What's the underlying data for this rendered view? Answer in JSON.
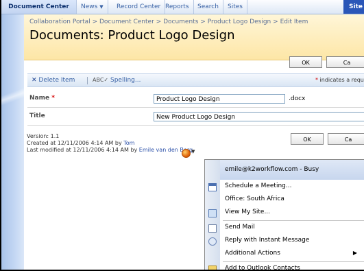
{
  "topnav": {
    "active_tab": "Document Center",
    "tabs": [
      "News",
      "Record Center",
      "Reports",
      "Search",
      "Sites"
    ],
    "site_label": "Site"
  },
  "breadcrumb": {
    "items": [
      "Collaboration Portal",
      "Document Center",
      "Documents",
      "Product Logo Design",
      "Edit Item"
    ],
    "separator": ">"
  },
  "page": {
    "title": "Documents: Product Logo Design"
  },
  "buttons": {
    "ok": "OK",
    "cancel": "Ca"
  },
  "toolbar": {
    "delete_label": "Delete Item",
    "spelling_label": "Spelling...",
    "required_note": "indicates a requi",
    "required_star": "*"
  },
  "form": {
    "name": {
      "label": "Name",
      "star": "*",
      "value": "Product Logo Design",
      "extension": ".docx"
    },
    "title": {
      "label": "Title",
      "value": "New Product Logo Design"
    }
  },
  "meta": {
    "version": "Version: 1.1",
    "created_prefix": "Created at 12/11/2006 4:14 AM  by",
    "created_by": "Tom",
    "modified_prefix": "Last modified at 12/11/2006 4:14 AM  by",
    "modified_by": "Emile van den Berg"
  },
  "context_menu": {
    "header": "emile@k2workflow.com - Busy",
    "items": [
      {
        "label": "Schedule a Meeting...",
        "icon": "calendar-icon"
      },
      {
        "label": "Office: South Africa",
        "icon": ""
      },
      {
        "label": "View My Site...",
        "icon": "mysite-icon"
      },
      {
        "label": "Send Mail",
        "icon": "mail-icon"
      },
      {
        "label": "Reply with Instant Message",
        "icon": "chat-icon"
      },
      {
        "label": "Additional Actions",
        "icon": ""
      },
      {
        "label": "Add to Outlook Contacts",
        "icon": "contact-icon"
      }
    ]
  }
}
